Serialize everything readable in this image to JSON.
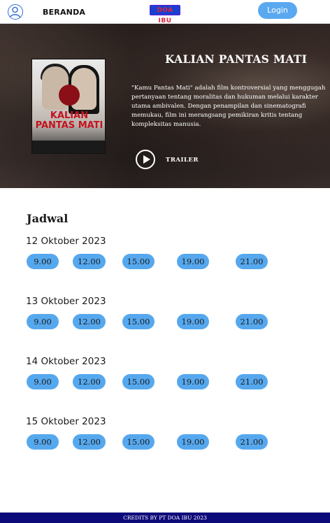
{
  "header": {
    "nav_label": "BERANDA",
    "logo_text": "DOA IBU",
    "login_label": "Login"
  },
  "hero": {
    "title": "KALIAN PANTAS MATI",
    "poster_title": "KALIAN PANTAS MATI",
    "description": "\"Kamu Pantas Mati\" adalah film kontroversial yang menggugah pertanyaan tentang moralitas dan hukuman melalui karakter utama ambivalen. Dengan penampilan dan sinematografi memukau, film ini merangsang pemikiran kritis tentang kompleksitas manusia.",
    "trailer_label": "TRAILER"
  },
  "schedule": {
    "title": "Jadwal",
    "days": [
      {
        "date": "12 Oktober 2023",
        "times": [
          "9.00",
          "12.00",
          "15.00",
          "19.00",
          "21.00"
        ]
      },
      {
        "date": "13 Oktober 2023",
        "times": [
          "9.00",
          "12.00",
          "15.00",
          "19.00",
          "21.00"
        ]
      },
      {
        "date": "14 Oktober 2023",
        "times": [
          "9.00",
          "12.00",
          "15.00",
          "19.00",
          "21.00"
        ]
      },
      {
        "date": "15 Oktober 2023",
        "times": [
          "9.00",
          "12.00",
          "15.00",
          "19.00",
          "21.00"
        ]
      }
    ]
  },
  "footer": {
    "credits": "CREDITS BY PT DOA IBU 2023"
  },
  "colors": {
    "accent": "#56a8ee",
    "footer": "#0d0a7a",
    "login": "#5aa9f0"
  },
  "icons": {
    "avatar": "user-avatar-icon",
    "play": "play-icon"
  }
}
